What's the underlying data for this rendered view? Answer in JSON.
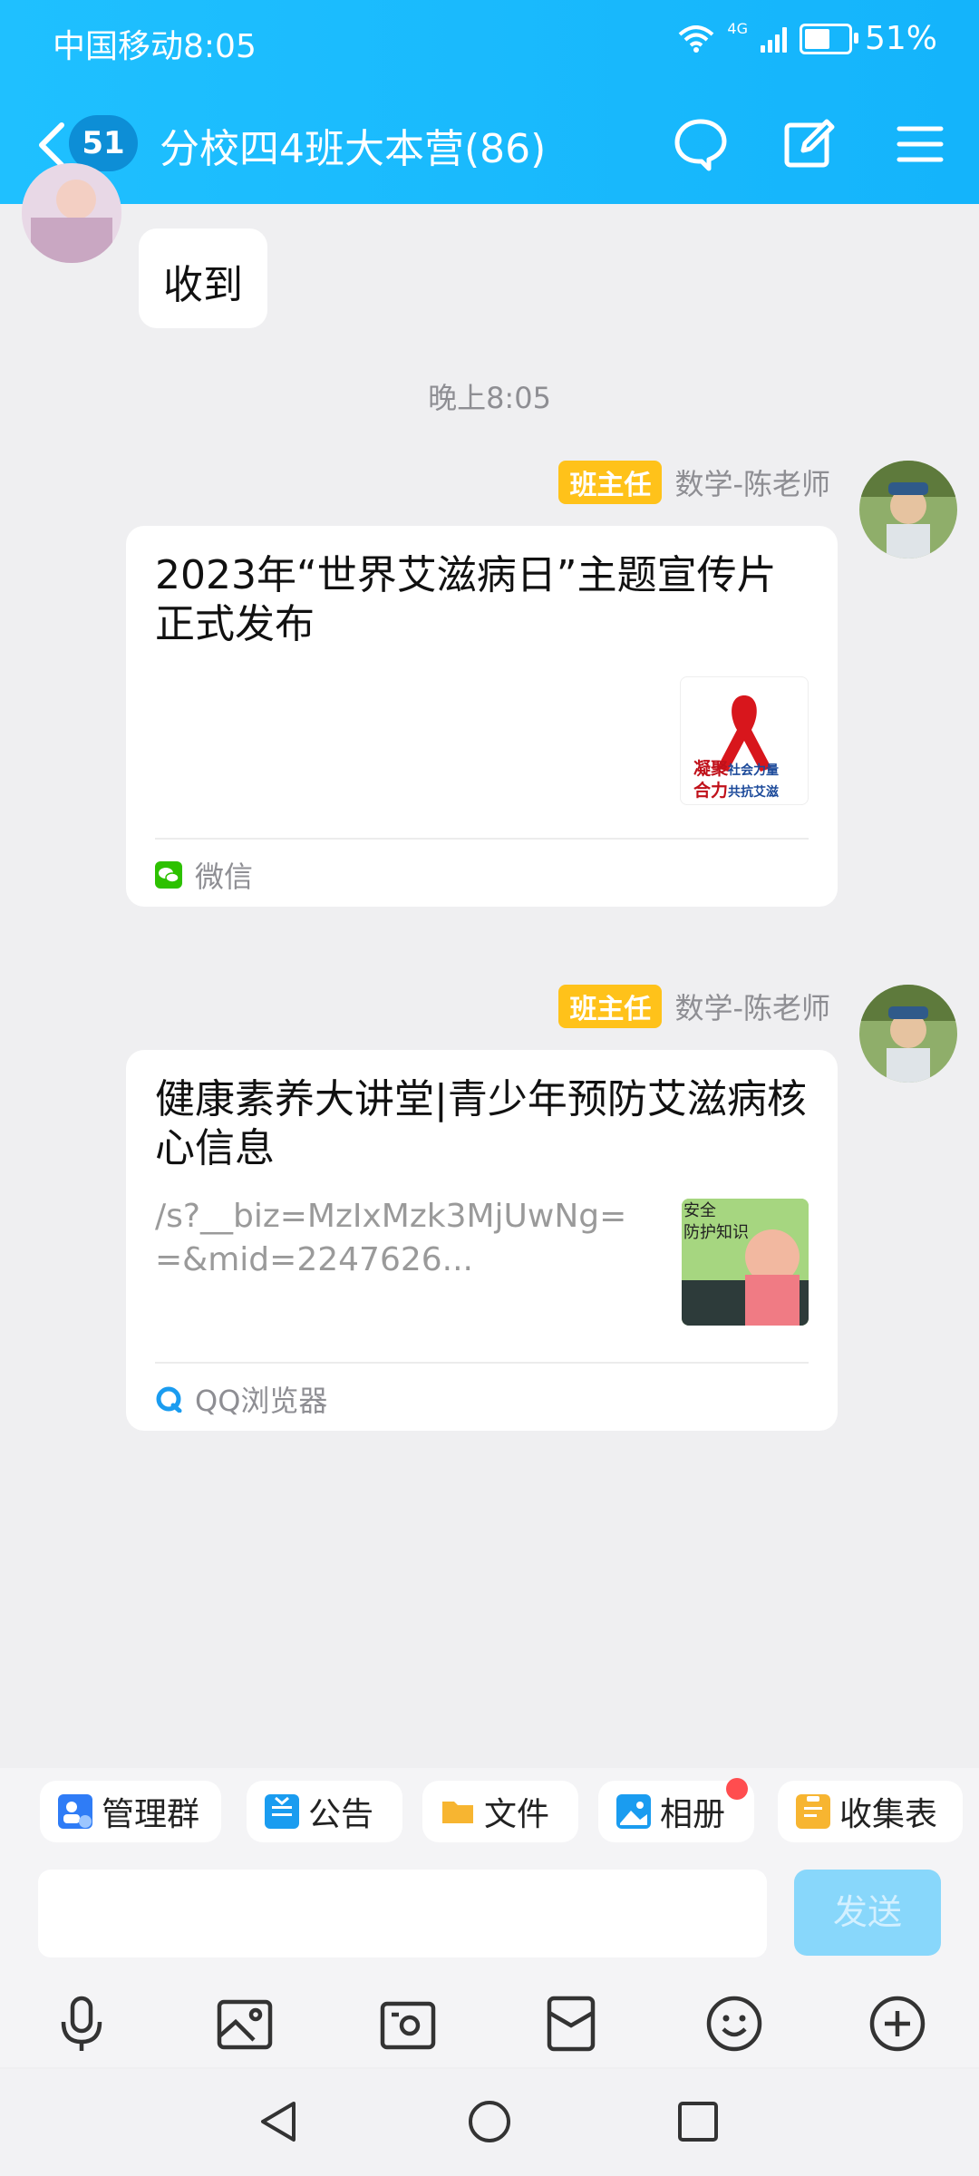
{
  "status_bar": {
    "carrier_time": "中国移动8:05",
    "network": "4G",
    "battery": "51%"
  },
  "header": {
    "unread_count": "51",
    "title": "分校四4班大本营(86)"
  },
  "messages": {
    "received_text": "收到",
    "timestamp": "晚上8:05",
    "card1": {
      "role": "班主任",
      "sender": "数学-陈老师",
      "title": "2023年“世界艾滋病日”主题宣传片正式发布",
      "thumb_line1a": "凝聚",
      "thumb_line1b": "社会力量",
      "thumb_line2a": "合力",
      "thumb_line2b": "共抗艾滋",
      "source": "微信"
    },
    "card2": {
      "role": "班主任",
      "sender": "数学-陈老师",
      "title": "健康素养大讲堂|青少年预防艾滋病核心信息",
      "desc": "/s?__biz=MzIxMzk3MjUwNg==&mid=2247626...",
      "thumb_line1": "安全",
      "thumb_line2": "防护知识",
      "source": "QQ浏览器"
    }
  },
  "quick_actions": [
    "管理群",
    "公告",
    "文件",
    "相册",
    "收集表"
  ],
  "input": {
    "placeholder": "",
    "send_label": "发送"
  },
  "colors": {
    "header": "#14b4fb",
    "badge": "#ffc21a",
    "send_disabled": "#88d7fb"
  }
}
